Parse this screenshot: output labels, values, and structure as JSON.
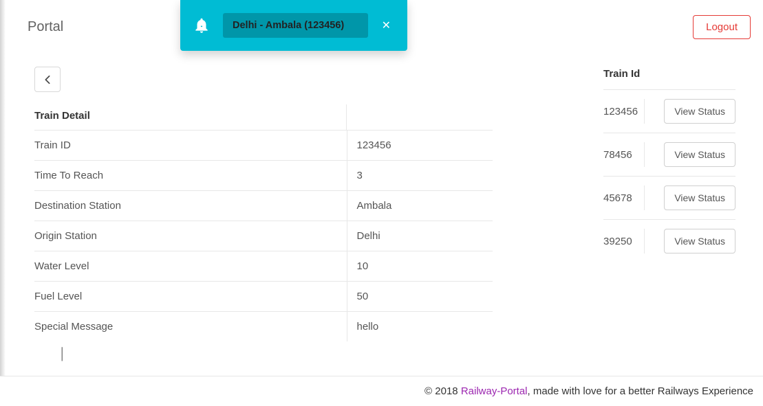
{
  "header": {
    "title": "Portal",
    "logout": "Logout"
  },
  "notification": {
    "text": "Delhi - Ambala (123456)"
  },
  "details": {
    "heading": "Train Detail",
    "rows": [
      {
        "label": "Train ID",
        "value": "123456"
      },
      {
        "label": "Time To Reach",
        "value": "3"
      },
      {
        "label": "Destination Station",
        "value": "Ambala"
      },
      {
        "label": "Origin Station",
        "value": "Delhi"
      },
      {
        "label": "Water Level",
        "value": "10"
      },
      {
        "label": "Fuel Level",
        "value": "50"
      },
      {
        "label": "Special Message",
        "value": "hello"
      }
    ]
  },
  "trainList": {
    "heading": "Train Id",
    "viewLabel": "View Status",
    "items": [
      {
        "id": "123456"
      },
      {
        "id": "78456"
      },
      {
        "id": "45678"
      },
      {
        "id": "39250"
      }
    ]
  },
  "footer": {
    "copyright": "© 2018 ",
    "link": "Railway-Portal",
    "tagline": ", made with love for a better Railways Experience"
  }
}
